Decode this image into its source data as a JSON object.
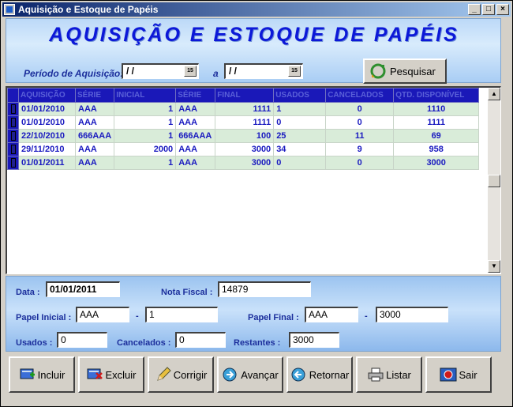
{
  "window": {
    "title": "Aquisição e Estoque de Papéis",
    "min_glyph": "_",
    "max_glyph": "□",
    "close_glyph": "×"
  },
  "header": {
    "title": "AQUISIÇÃO E ESTOQUE DE PAPÉIS",
    "period_label": "Período de Aquisição:",
    "date_from": "/ /",
    "date_to": "/ /",
    "between_label": "a",
    "calendar_glyph": "15",
    "search_label": "Pesquisar"
  },
  "grid": {
    "columns": [
      "AQUISIÇÃO",
      "SÉRIE",
      "INICIAL",
      "SÉRIE",
      "FINAL",
      "USADOS",
      "CANCELADOS",
      "QTD. DISPONÍVEL"
    ],
    "rows": [
      [
        "01/01/2010",
        "AAA",
        "1",
        "AAA",
        "1111",
        "1",
        "0",
        "1110"
      ],
      [
        "01/01/2010",
        "AAA",
        "1",
        "AAA",
        "1111",
        "0",
        "0",
        "1111"
      ],
      [
        "22/10/2010",
        "666AAA",
        "1",
        "666AAA",
        "100",
        "25",
        "11",
        "69"
      ],
      [
        "29/11/2010",
        "AAA",
        "2000",
        "AAA",
        "3000",
        "34",
        "9",
        "958"
      ],
      [
        "01/01/2011",
        "AAA",
        "1",
        "AAA",
        "3000",
        "0",
        "0",
        "3000"
      ]
    ],
    "scroll_up_glyph": "▲",
    "scroll_down_glyph": "▼"
  },
  "details": {
    "data_label": "Data :",
    "data_value": "01/01/2011",
    "nota_label": "Nota Fiscal :",
    "nota_value": "14879",
    "papel_inicial_label": "Papel Inicial :",
    "papel_inicial_serie": "AAA",
    "papel_inicial_num": "1",
    "papel_final_label": "Papel Final :",
    "papel_final_serie": "AAA",
    "papel_final_num": "3000",
    "dash": "-",
    "usados_label": "Usados :",
    "usados_value": "0",
    "cancelados_label": "Cancelados :",
    "cancelados_value": "0",
    "restantes_label": "Restantes :",
    "restantes_value": "3000"
  },
  "footer": {
    "incluir": "Incluir",
    "excluir": "Excluir",
    "corrigir": "Corrigir",
    "avancar": "Avançar",
    "retornar": "Retornar",
    "listar": "Listar",
    "sair": "Sair"
  },
  "colors": {
    "title_blue": "#0c18d8",
    "grid_header": "#1a18b8",
    "grid_row_alt": "#d9ecd9",
    "grid_text": "#1a1ac0"
  }
}
